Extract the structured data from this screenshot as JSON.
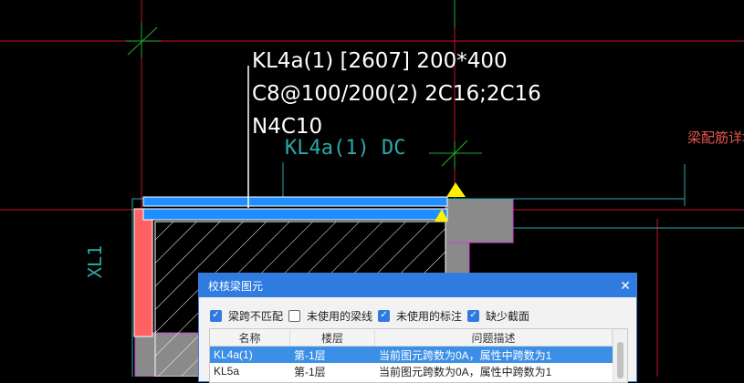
{
  "beam_annotation": {
    "line1": "KL4a(1) [2607] 200*400",
    "line2": "C8@100/200(2) 2C16;2C16",
    "line3": "N4C10"
  },
  "cad_labels": {
    "beam_label": "KL4a(1) DC",
    "column_label": "XL1",
    "side_note": "梁配筋详地下"
  },
  "colors": {
    "beam_blue": "#1f8fff",
    "column_red": "#ff6262",
    "wall_gray": "#8a8a8a",
    "grid_red": "#c8102e",
    "axis_green": "#25b02a",
    "marker_yellow": "#ffee00",
    "dialog_blue": "#2f7be0"
  },
  "dialog": {
    "title": "校核梁图元",
    "close_icon": "close-icon",
    "filters": [
      {
        "label": "梁跨不匹配",
        "checked": true
      },
      {
        "label": "未使用的梁线",
        "checked": false
      },
      {
        "label": "未使用的标注",
        "checked": true
      },
      {
        "label": "缺少截面",
        "checked": true
      }
    ],
    "table": {
      "headers": [
        "名称",
        "楼层",
        "问题描述"
      ],
      "rows": [
        {
          "name": "KL4a(1)",
          "floor": "第-1层",
          "desc": "当前图元跨数为0A，属性中跨数为1",
          "selected": true
        },
        {
          "name": "KL5a",
          "floor": "第-1层",
          "desc": "当前图元跨数为0A，属性中跨数为1",
          "selected": false
        }
      ]
    }
  }
}
